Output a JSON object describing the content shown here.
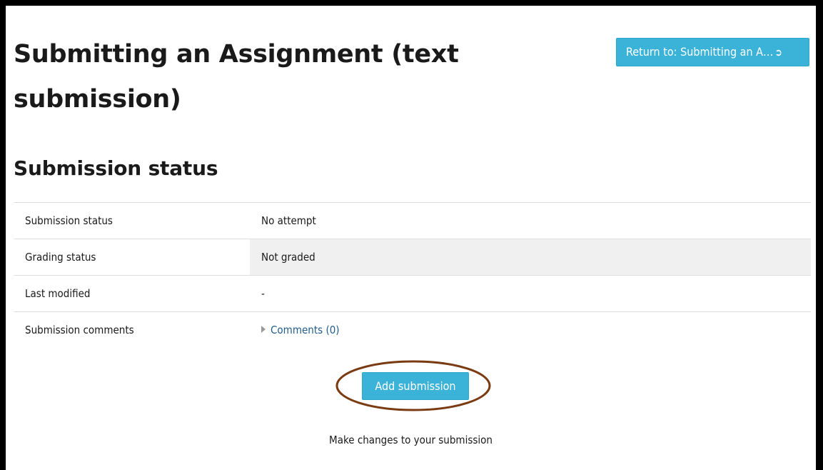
{
  "header": {
    "title": "Submitting an Assignment (text submission)",
    "return_button_label": "Return to: Submitting an A…",
    "return_icon": "enter-icon"
  },
  "submission": {
    "heading": "Submission status",
    "rows": [
      {
        "label": "Submission status",
        "value": "No attempt"
      },
      {
        "label": "Grading status",
        "value": "Not graded"
      },
      {
        "label": "Last modified",
        "value": "-"
      },
      {
        "label": "Submission comments",
        "value": "Comments (0)"
      }
    ],
    "add_button_label": "Add submission",
    "hint": "Make changes to your submission"
  },
  "colors": {
    "button": "#3bb3d9",
    "link": "#1f5d8c",
    "highlight": "#7a3b12",
    "row_shade": "#f0f0f0"
  }
}
